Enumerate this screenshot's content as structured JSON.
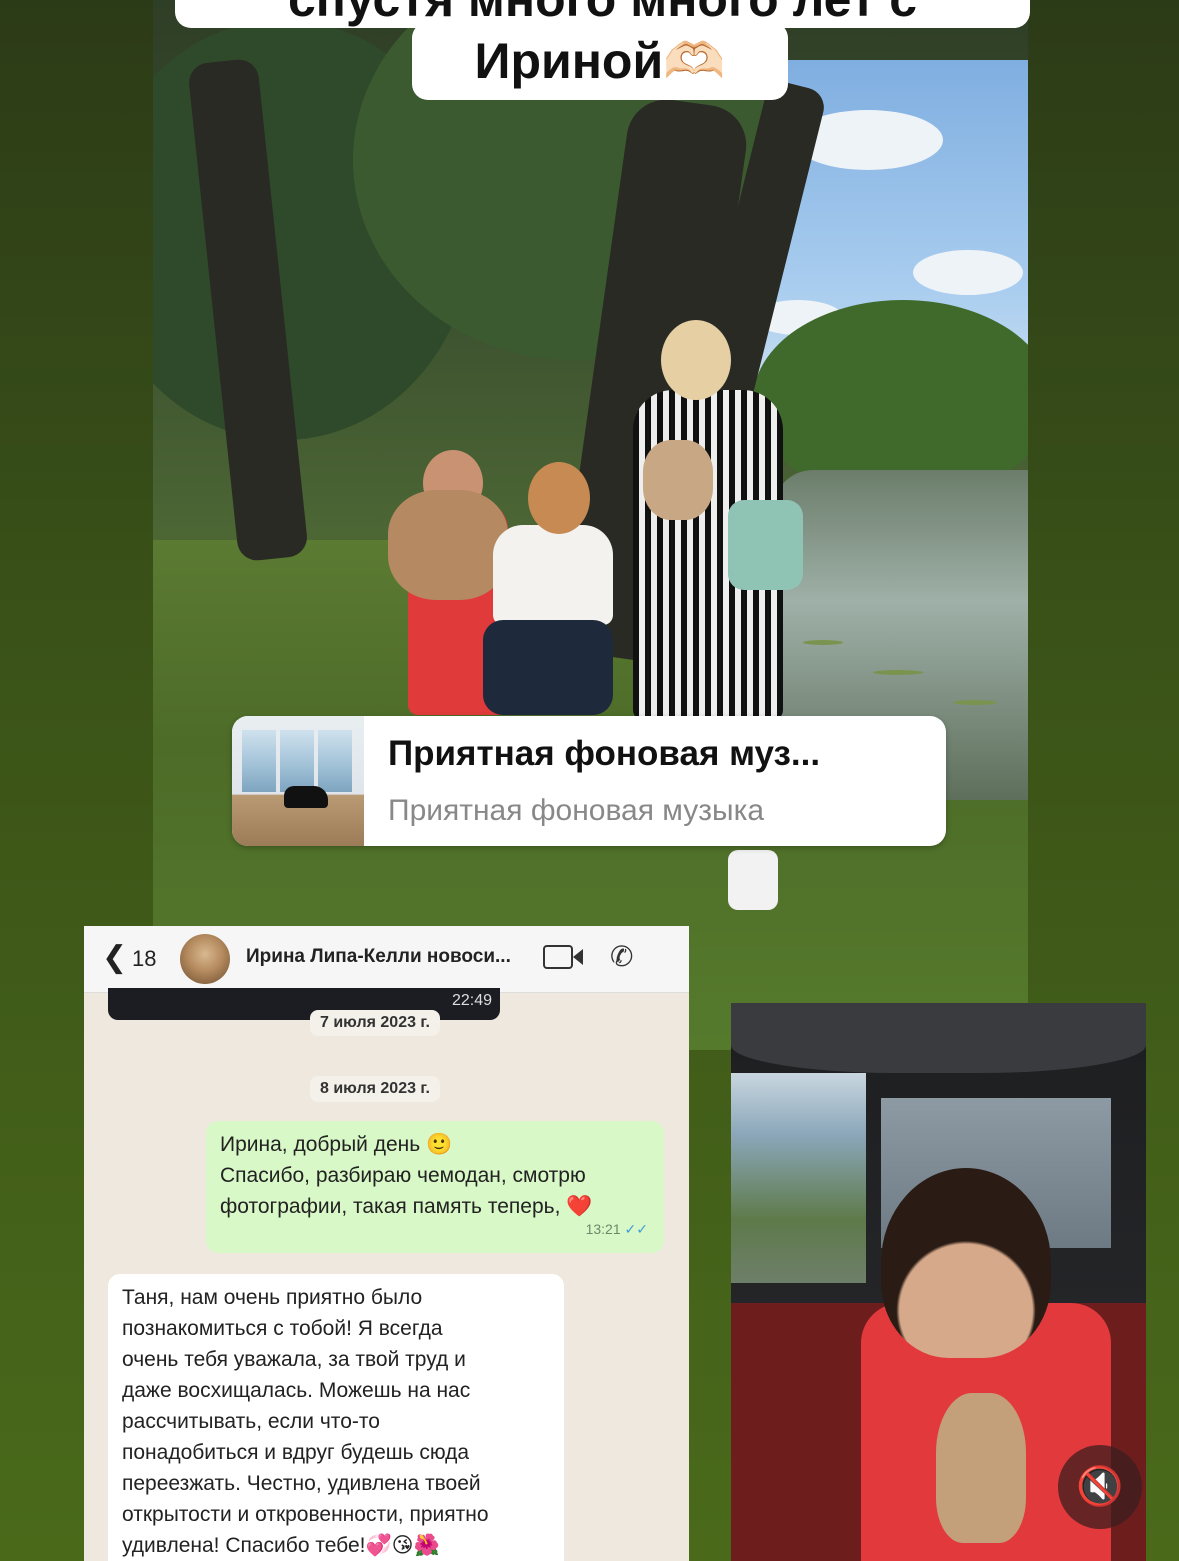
{
  "story": {
    "title_line_1": "спустя много много лет с",
    "title_line_2": "Ириной🫶🏻"
  },
  "music_sticker": {
    "title": "Приятная фоновая муз...",
    "subtitle": "Приятная фоновая музыка"
  },
  "chat": {
    "header": {
      "back_count": "18",
      "contact_name": "Ирина Липа-Келли новоси...",
      "icons": [
        "back-chevron",
        "video-call-icon",
        "phone-icon"
      ]
    },
    "previous_media_time": "22:49",
    "date_1": "7 июля 2023 г.",
    "date_2": "8 июля 2023 г.",
    "outgoing": {
      "line_1": "Ирина, добрый день 🙂",
      "line_2": "Спасибо, разбираю чемодан, смотрю",
      "line_3": "фотографии, такая память теперь,",
      "emoji": "❤️",
      "time": "13:21",
      "status": "✓✓"
    },
    "incoming": {
      "lines": [
        "Таня, нам очень приятно было",
        "познакомиться с тобой! Я всегда",
        "очень тебя уважала, за твой труд и",
        "даже восхищалась. Можешь на нас",
        "рассчитывать, если что-то",
        "понадобиться и вдруг будешь сюда",
        "переезжать. Честно, удивлена твоей",
        "открытости и откровенности, приятно",
        "удивлена! Спасибо тебе!💞😘🌺"
      ]
    }
  },
  "controls": {
    "mute_icon": "🔇"
  },
  "colors": {
    "background": "#3a5218",
    "outgoing_bubble": "#d9f8c7",
    "chat_bg": "#efe8df",
    "read_ticks": "#3b9bd8"
  }
}
